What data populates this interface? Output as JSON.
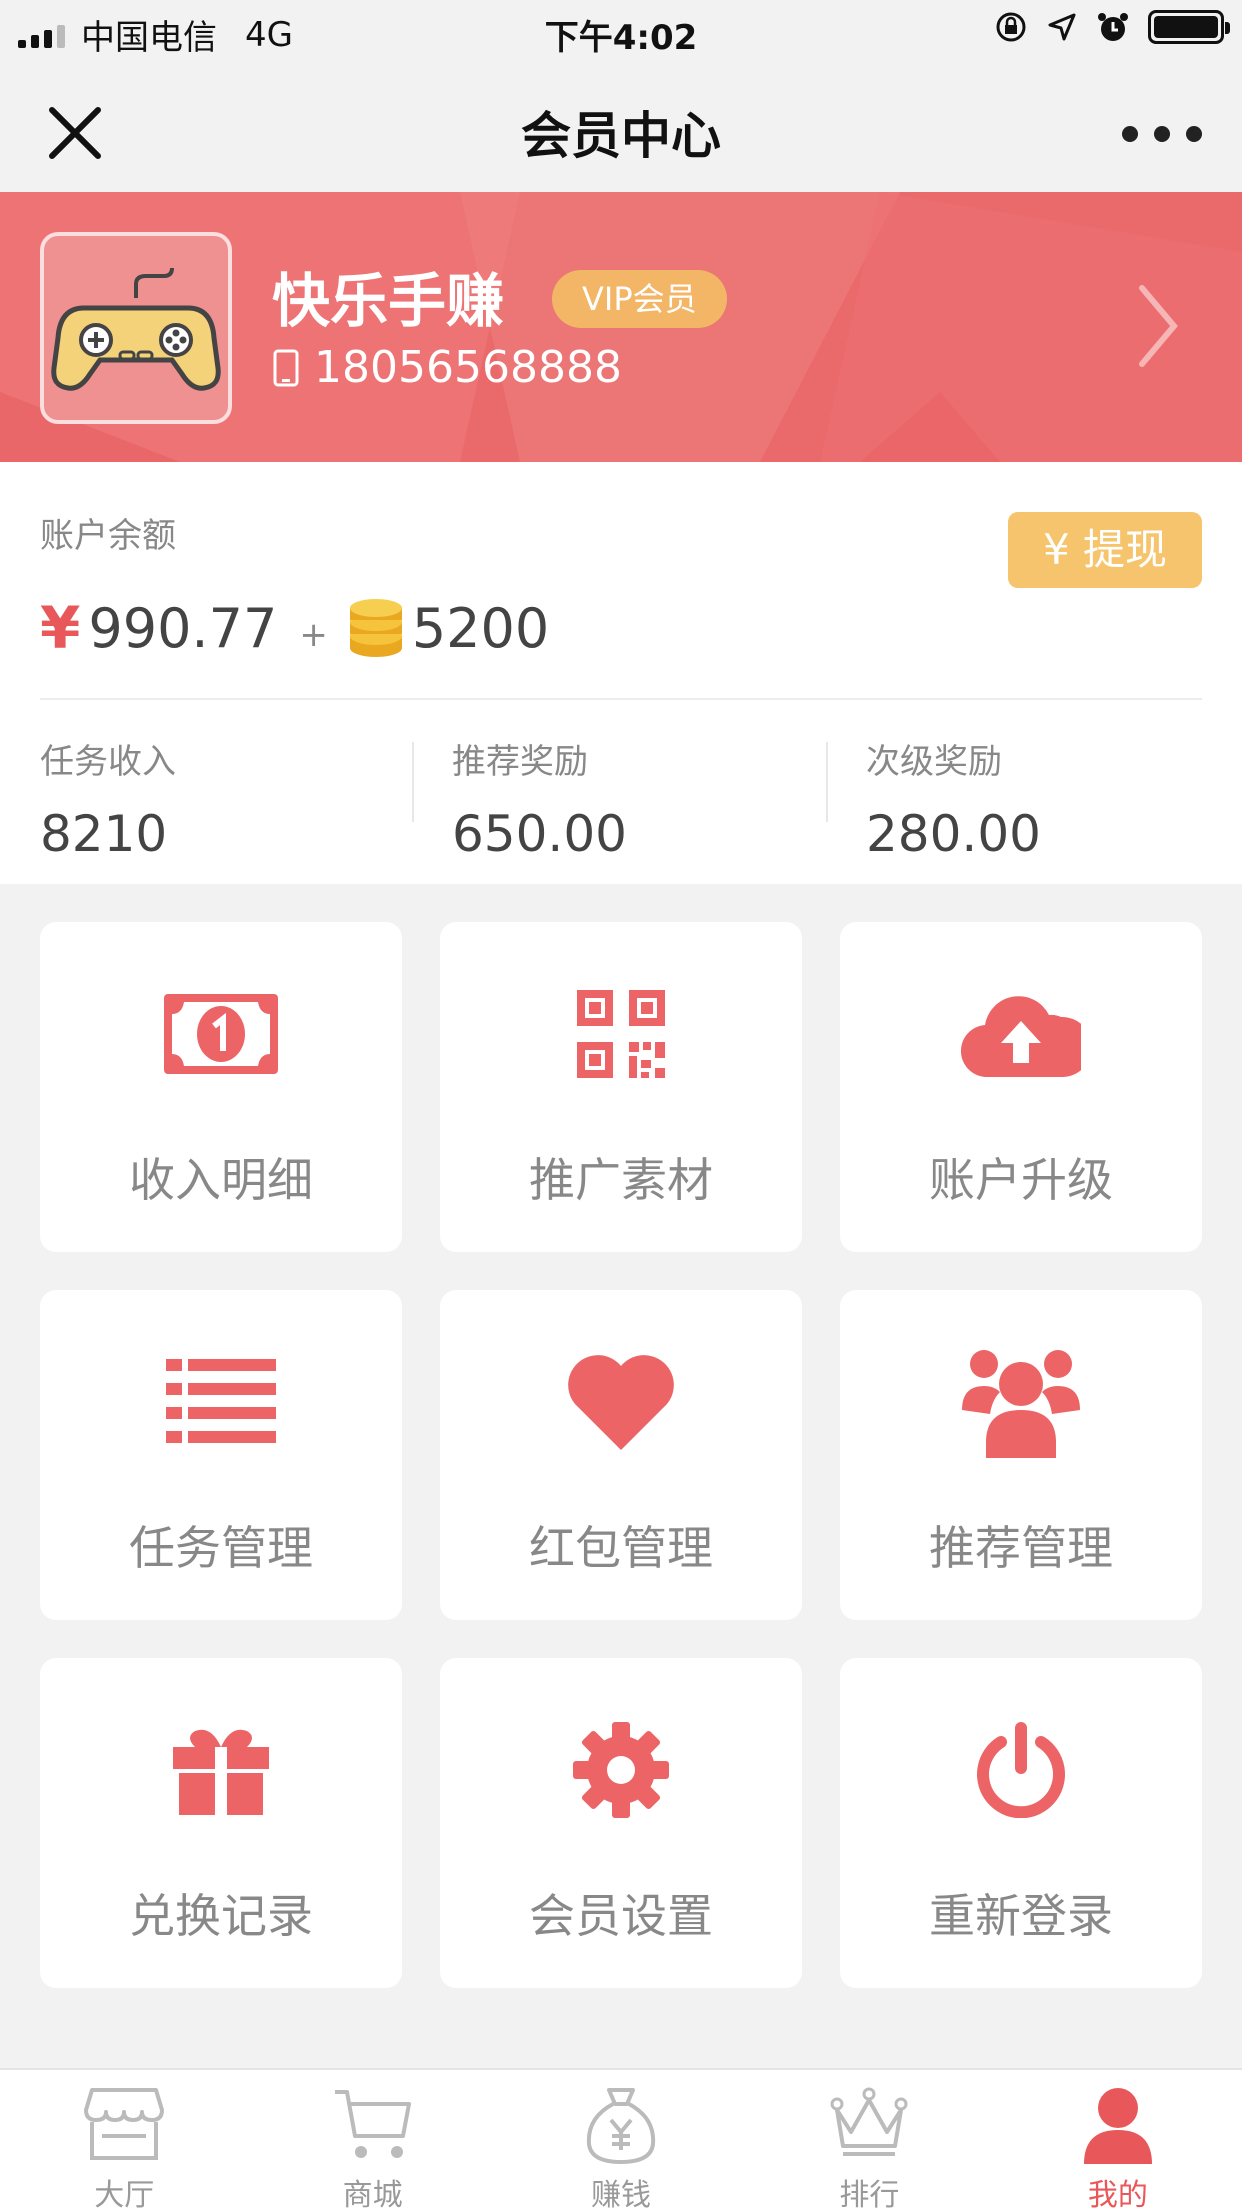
{
  "status_bar": {
    "carrier": "中国电信",
    "network": "4G",
    "time": "下午4:02"
  },
  "nav": {
    "title": "会员中心"
  },
  "profile": {
    "name": "快乐手赚",
    "badge": "VIP会员",
    "phone": "18056568888"
  },
  "balance": {
    "label": "账户余额",
    "currency": "¥",
    "amount": "990.77",
    "plus": "+",
    "coins": "5200",
    "withdraw_label": "¥ 提现"
  },
  "stats": [
    {
      "label": "任务收入",
      "value": "8210"
    },
    {
      "label": "推荐奖励",
      "value": "650.00"
    },
    {
      "label": "次级奖励",
      "value": "280.00"
    }
  ],
  "menu": [
    {
      "label": "收入明细",
      "icon": "money-bill-icon"
    },
    {
      "label": "推广素材",
      "icon": "qrcode-icon"
    },
    {
      "label": "账户升级",
      "icon": "cloud-upload-icon"
    },
    {
      "label": "任务管理",
      "icon": "list-icon"
    },
    {
      "label": "红包管理",
      "icon": "heart-icon"
    },
    {
      "label": "推荐管理",
      "icon": "users-icon"
    },
    {
      "label": "兑换记录",
      "icon": "gift-icon"
    },
    {
      "label": "会员设置",
      "icon": "gear-icon"
    },
    {
      "label": "重新登录",
      "icon": "power-icon"
    }
  ],
  "tabs": [
    {
      "label": "大厅",
      "icon": "store-icon"
    },
    {
      "label": "商城",
      "icon": "cart-icon"
    },
    {
      "label": "赚钱",
      "icon": "money-bag-icon"
    },
    {
      "label": "排行",
      "icon": "crown-icon"
    },
    {
      "label": "我的",
      "icon": "user-icon"
    }
  ],
  "colors": {
    "accent": "#e8585a",
    "banner": "#ea6a6c",
    "withdraw": "#f6c46c",
    "vip_badge": "#f3b566",
    "icon": "#ec6466"
  }
}
